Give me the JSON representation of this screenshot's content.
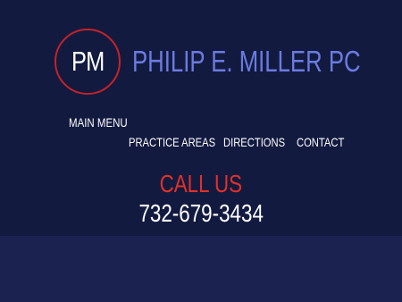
{
  "logo": {
    "initials": "PM"
  },
  "firm": {
    "name": "PHILIP E. MILLER PC"
  },
  "menu": {
    "toggle_label": "MAIN MENU",
    "items": [
      {
        "label": "PRACTICE AREAS"
      },
      {
        "label": "DIRECTIONS"
      },
      {
        "label": "CONTACT"
      }
    ]
  },
  "call": {
    "heading": "CALL US",
    "phone": "732-679-3434"
  },
  "colors": {
    "header_bg": "#121a40",
    "band_bg": "#1b2250",
    "logo_ring": "#c42328",
    "firm_name": "#6c7be0",
    "call_heading": "#e0312a",
    "text": "#ffffff"
  }
}
